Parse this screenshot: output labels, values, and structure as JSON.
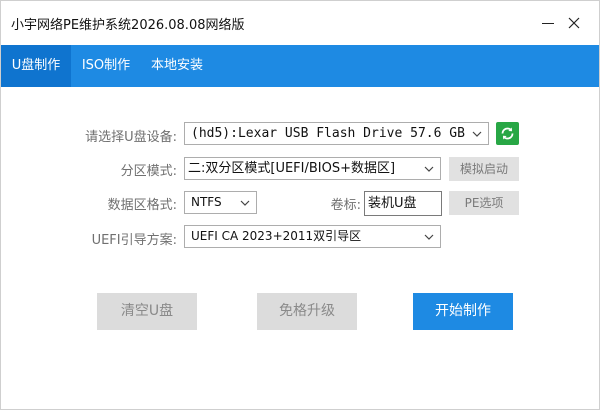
{
  "window": {
    "title": "小宇网络PE维护系统2026.08.08网络版"
  },
  "tabs": [
    {
      "label": "U盘制作",
      "active": true
    },
    {
      "label": "ISO制作",
      "active": false
    },
    {
      "label": "本地安装",
      "active": false
    }
  ],
  "form": {
    "device_label": "请选择U盘设备:",
    "device_value": "(hd5):Lexar USB Flash Drive 57.6 GB",
    "partition_label": "分区模式:",
    "partition_value": "二:双分区模式[UEFI/BIOS+数据区]",
    "simulate_button": "模拟启动",
    "format_label": "数据区格式:",
    "format_value": "NTFS",
    "volume_label": "卷标:",
    "volume_value": "装机U盘",
    "pe_options_button": "PE选项",
    "uefi_label": "UEFI引导方案:",
    "uefi_value": "UEFI CA 2023+2011双引导区"
  },
  "actions": {
    "clear_button": "清空U盘",
    "upgrade_button": "免格升级",
    "start_button": "开始制作"
  },
  "colors": {
    "accent": "#1e8ae3",
    "tab_active": "#0f74cf",
    "refresh": "#28a745"
  },
  "icons": {
    "minimize": "minimize-icon",
    "close": "close-icon",
    "refresh": "refresh-icon",
    "dropdown": "chevron-down-icon"
  }
}
